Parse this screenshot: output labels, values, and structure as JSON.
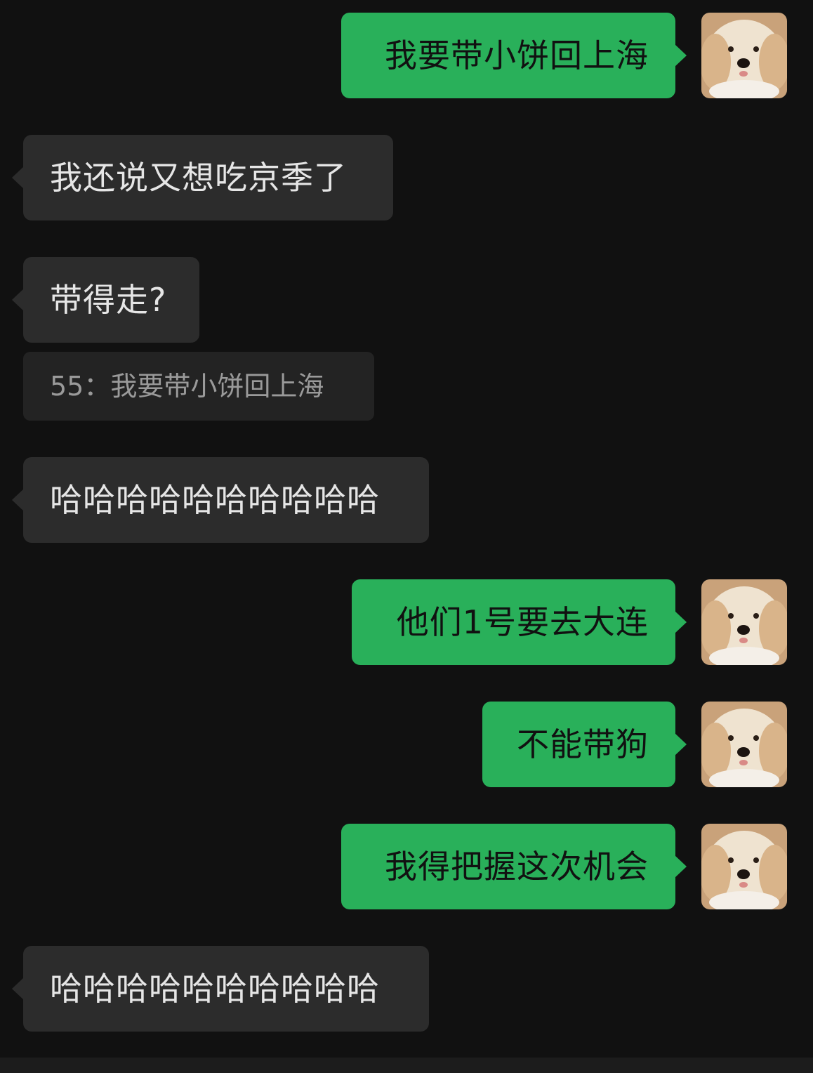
{
  "messages": [
    {
      "text": "我要带小饼回上海",
      "direction": "sent"
    },
    {
      "text": "我还说又想吃京季了",
      "direction": "received"
    },
    {
      "text": "带得走?",
      "direction": "received"
    },
    {
      "quote": "55：我要带小饼回上海"
    },
    {
      "text": "哈哈哈哈哈哈哈哈哈哈",
      "direction": "received"
    },
    {
      "text": "他们1号要去大连",
      "direction": "sent"
    },
    {
      "text": "不能带狗",
      "direction": "sent"
    },
    {
      "text": "我得把握这次机会",
      "direction": "sent"
    },
    {
      "text": "哈哈哈哈哈哈哈哈哈哈",
      "direction": "received"
    }
  ],
  "avatar_icon": "dog-avatar-icon",
  "colors": {
    "background": "#111111",
    "sent_bubble": "#29b05a",
    "received_bubble": "#2c2c2c",
    "quote_box": "#232323"
  }
}
